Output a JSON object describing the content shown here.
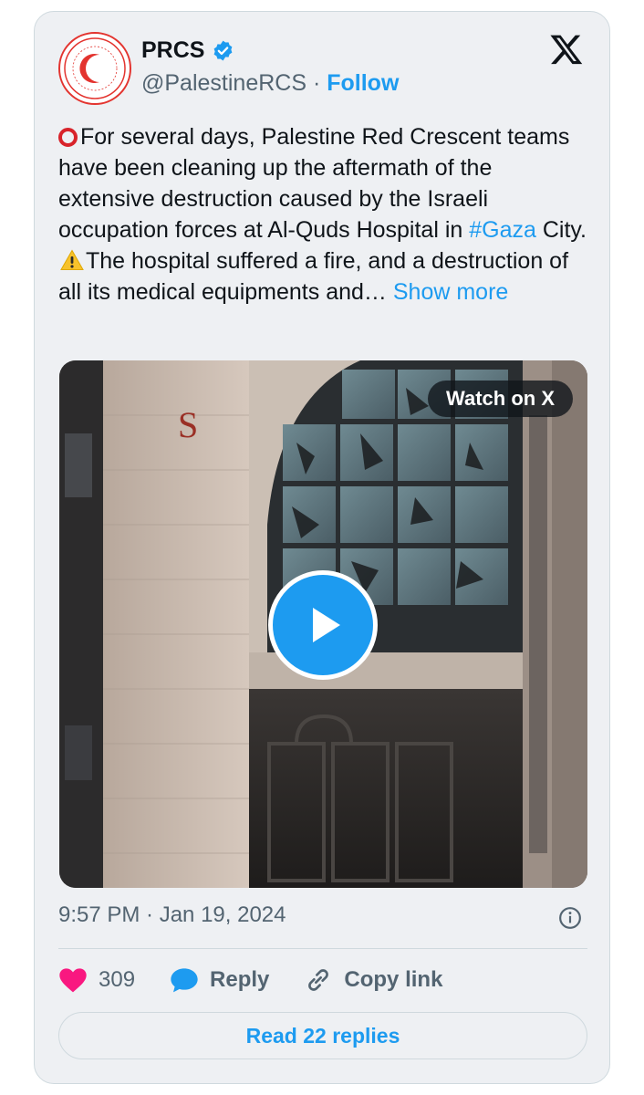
{
  "author": {
    "name": "PRCS",
    "handle": "@PalestineRCS",
    "separator": "·",
    "follow_label": "Follow",
    "verified_color": "#1d9bf0",
    "avatar_logo": "red-crescent-logo"
  },
  "brand_logo": "x-logo",
  "tweet": {
    "text_lead": "For several days, Palestine Red Crescent teams have been cleaning up the aftermath of the extensive destruction caused by the Israeli occupation forces at Al-Quds Hospital in ",
    "hashtag": "#Gaza",
    "text_mid": " City. ",
    "text_after_warning": "The hospital suffered a fire, and a destruction of all its medical equipments and…",
    "show_more": "Show more",
    "lead_icon": "red-circle-icon",
    "warning_icon": "warning-icon"
  },
  "media": {
    "watch_label": "Watch on X",
    "play_icon": "play-icon"
  },
  "timestamp": "9:57 PM · Jan 19, 2024",
  "actions": {
    "like_count": "309",
    "reply_label": "Reply",
    "copy_link_label": "Copy link",
    "like_color": "#f91880",
    "reply_color": "#1d9bf0"
  },
  "read_replies_label": "Read 22 replies"
}
